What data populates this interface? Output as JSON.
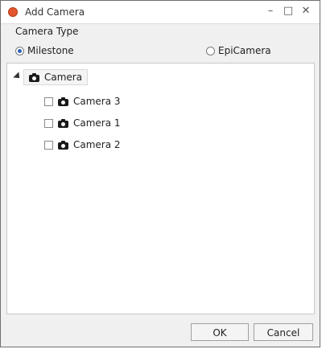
{
  "window": {
    "title": "Add Camera",
    "min_glyph": "–",
    "max_glyph": "□",
    "close_glyph": "✕"
  },
  "camera_type": {
    "label": "Camera Type",
    "options": [
      {
        "label": "Milestone",
        "selected": true
      },
      {
        "label": "EpiCamera",
        "selected": false
      }
    ]
  },
  "tree": {
    "root": {
      "label": "Camera",
      "icon": "camera-icon"
    },
    "children": [
      {
        "label": "Camera 3",
        "checked": false
      },
      {
        "label": "Camera 1",
        "checked": false
      },
      {
        "label": "Camera 2",
        "checked": false
      }
    ]
  },
  "buttons": {
    "ok": "OK",
    "cancel": "Cancel"
  }
}
